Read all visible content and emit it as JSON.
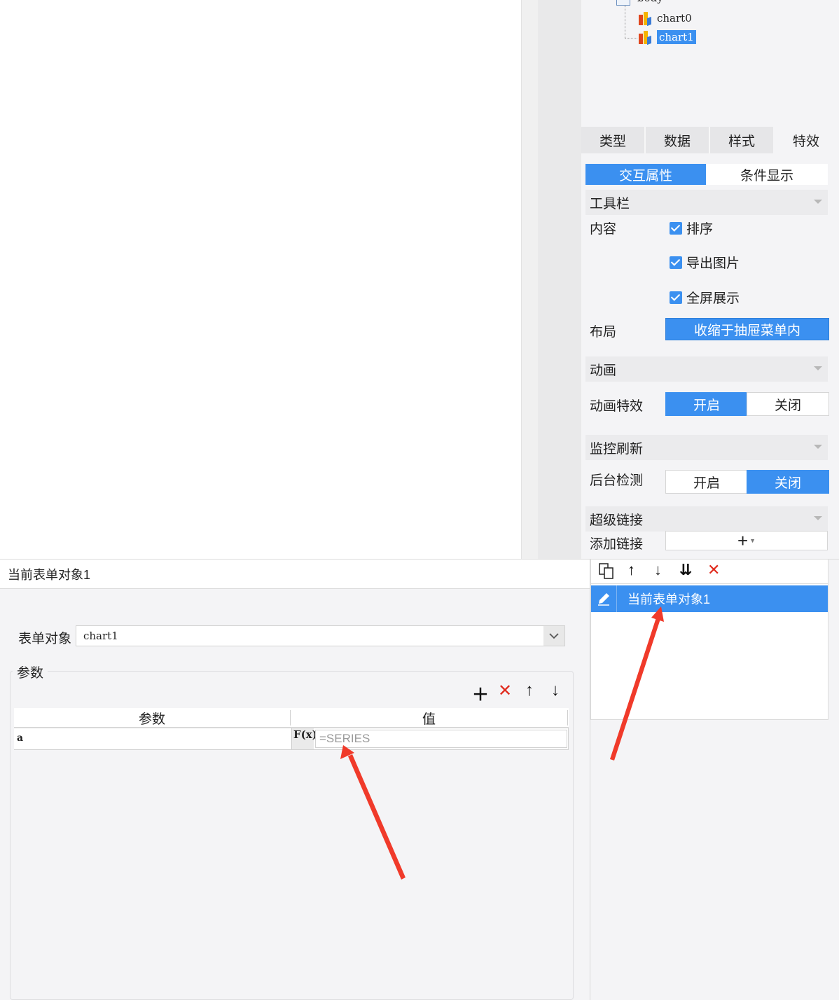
{
  "tree": {
    "root_label": "body",
    "items": [
      {
        "label": "chart0",
        "selected": false
      },
      {
        "label": "chart1",
        "selected": true
      }
    ]
  },
  "tabs": [
    "类型",
    "数据",
    "样式",
    "特效"
  ],
  "active_tab": "特效",
  "subtabs": [
    "交互属性",
    "条件显示"
  ],
  "active_subtab": "交互属性",
  "sections": {
    "toolbar": {
      "title": "工具栏",
      "content_label": "内容",
      "checks": [
        {
          "label": "排序",
          "checked": true
        },
        {
          "label": "导出图片",
          "checked": true
        },
        {
          "label": "全屏展示",
          "checked": true
        }
      ],
      "layout_label": "布局",
      "layout_value": "收缩于抽屉菜单内"
    },
    "animation": {
      "title": "动画",
      "effect_label": "动画特效",
      "on_label": "开启",
      "off_label": "关闭",
      "selected": "开启"
    },
    "refresh": {
      "title": "监控刷新",
      "detect_label": "后台检测",
      "on_label": "开启",
      "off_label": "关闭",
      "selected": "关闭"
    },
    "hyperlink": {
      "title": "超级链接",
      "add_label": "添加链接",
      "add_icon": "plus-dropdown-icon"
    }
  },
  "link_editor": {
    "header_title": "当前表单对象1",
    "form_object_label": "表单对象",
    "form_object_value": "chart1",
    "params_group_label": "参数",
    "table": {
      "headers": [
        "参数",
        "值"
      ],
      "rows": [
        {
          "name": "a",
          "formula_icon": "F(x)",
          "value": "=SERIES"
        }
      ]
    }
  },
  "link_list": {
    "items": [
      {
        "label": "当前表单对象1",
        "selected": true
      }
    ]
  },
  "colors": {
    "accent": "#3b90f0",
    "delete_red": "#e0291c",
    "annotation_arrow": "#f03a2a"
  }
}
